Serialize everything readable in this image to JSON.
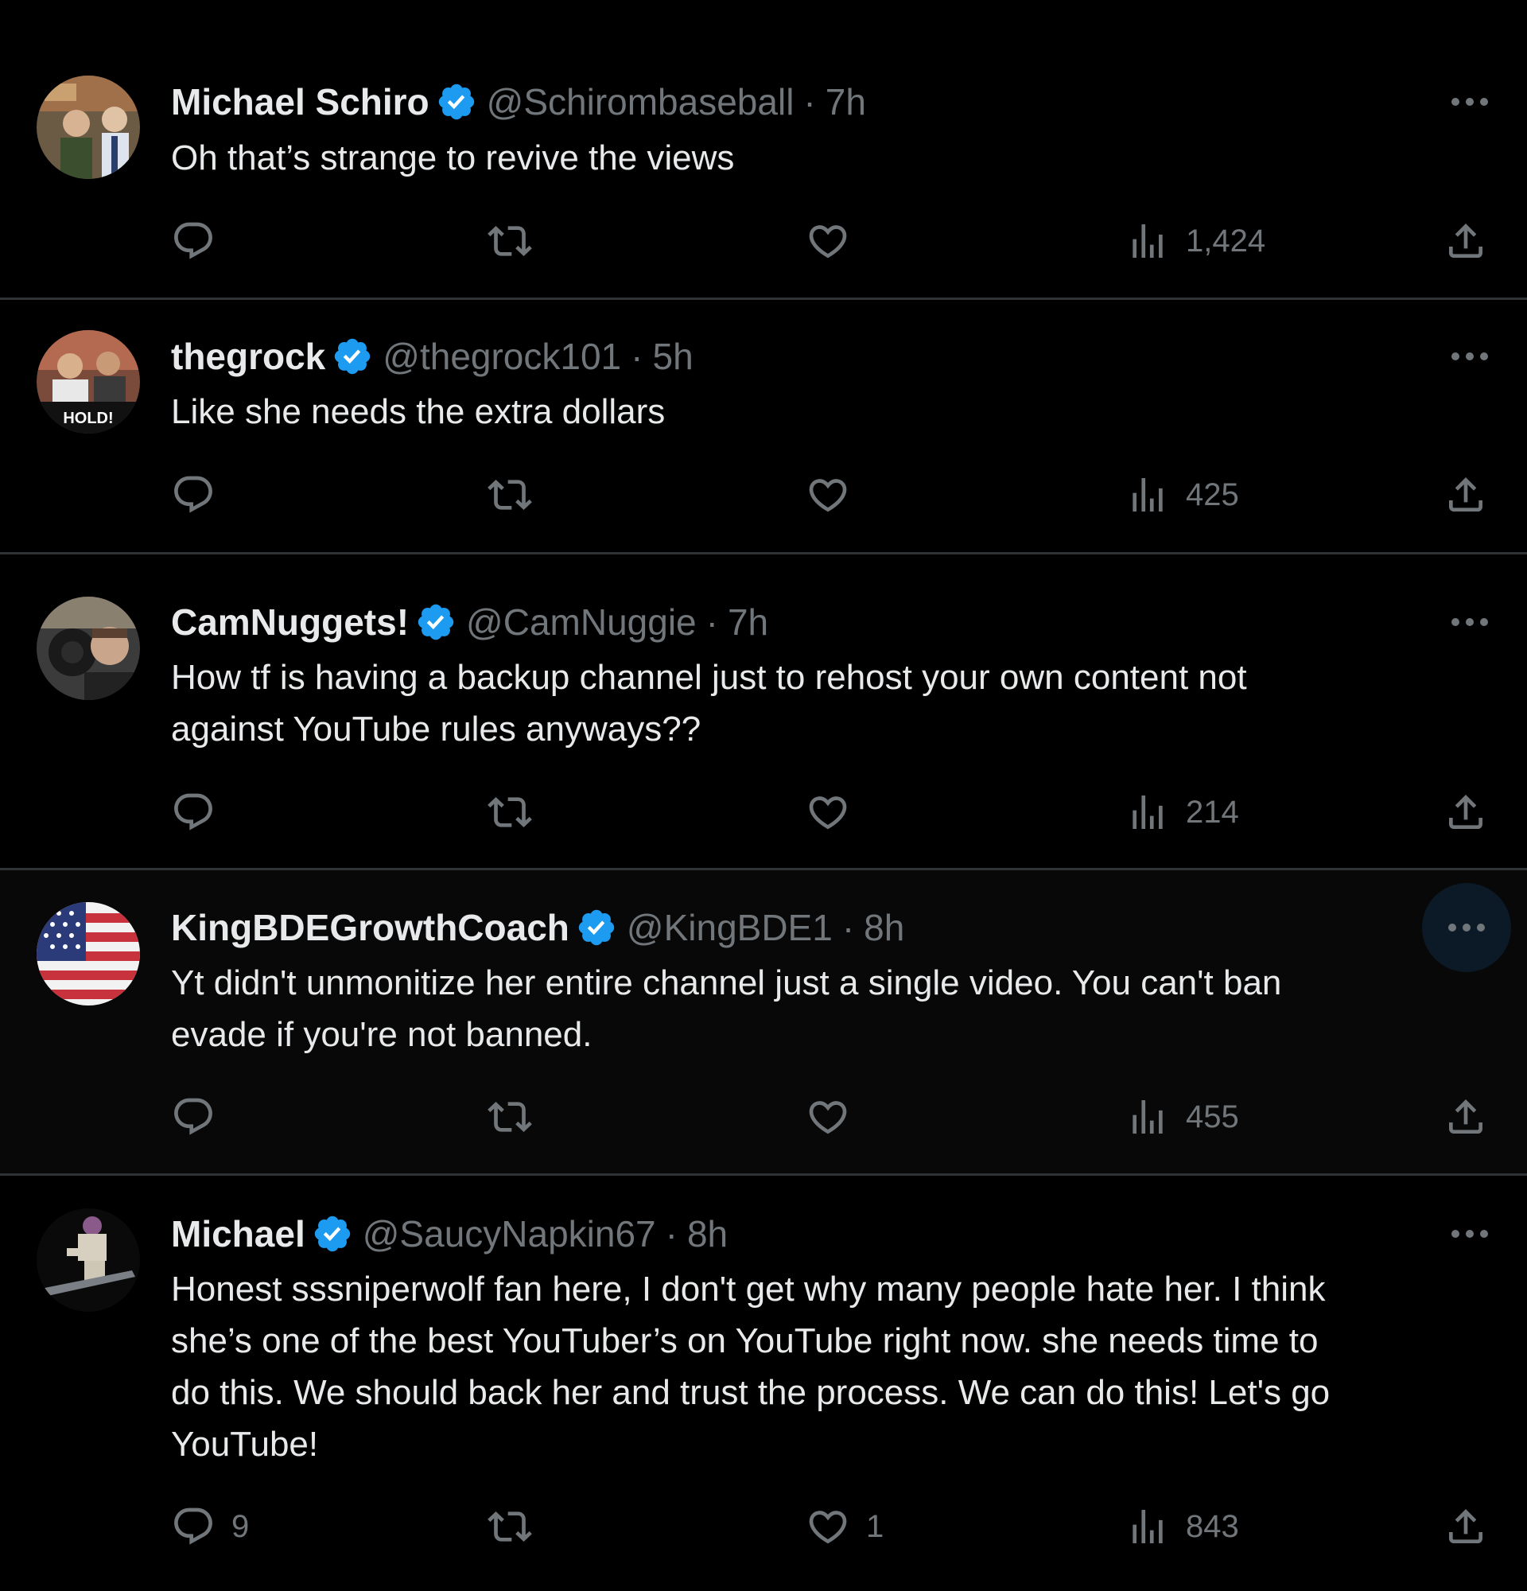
{
  "colors": {
    "background": "#000000",
    "hover_background": "#080808",
    "text_primary": "#e7e9ea",
    "text_secondary": "#71767b",
    "verified_badge": "#1d9bf0",
    "divider": "#2f3336",
    "more_active_bg": "#0b1a26"
  },
  "icons": {
    "reply": "speech-bubble-icon",
    "retweet": "retweet-arrows-icon",
    "like": "heart-icon",
    "views": "bar-chart-icon",
    "share": "share-upload-icon",
    "more": "ellipsis-icon",
    "verified": "verified-badge-icon"
  },
  "tweets": [
    {
      "name": "Michael Schiro",
      "handle": "@Schirombaseball",
      "separator": "·",
      "time": "7h",
      "text": "Oh that’s strange to revive the views",
      "reply_count": "",
      "retweet_count": "",
      "like_count": "",
      "views": "1,424"
    },
    {
      "name": "thegrock",
      "handle": "@thegrock101",
      "separator": "·",
      "time": "5h",
      "text": "Like she needs the extra dollars",
      "reply_count": "",
      "retweet_count": "",
      "like_count": "",
      "views": "425",
      "avatar_caption": "HOLD!"
    },
    {
      "name": "CamNuggets!",
      "handle": "@CamNuggie",
      "separator": "·",
      "time": "7h",
      "text": "How tf is having a backup channel just to rehost your own content not\nagainst YouTube rules anyways??",
      "reply_count": "",
      "retweet_count": "",
      "like_count": "",
      "views": "214"
    },
    {
      "name": "KingBDEGrowthCoach",
      "handle": "@KingBDE1",
      "separator": "·",
      "time": "8h",
      "text": "Yt didn't unmonitize her entire channel just a single video. You can't ban\nevade if you're not banned.",
      "reply_count": "",
      "retweet_count": "",
      "like_count": "",
      "views": "455"
    },
    {
      "name": "Michael",
      "handle": "@SaucyNapkin67",
      "separator": "·",
      "time": "8h",
      "text": "Honest sssniperwolf fan here, I don't get why many people hate her. I think\nshe’s  one of the best YouTuber’s  on YouTube right now. she needs time to\ndo this. We should back her and trust the process. We can do this! Let's go\nYouTube!",
      "reply_count": "9",
      "retweet_count": "",
      "like_count": "1",
      "views": "843"
    }
  ]
}
